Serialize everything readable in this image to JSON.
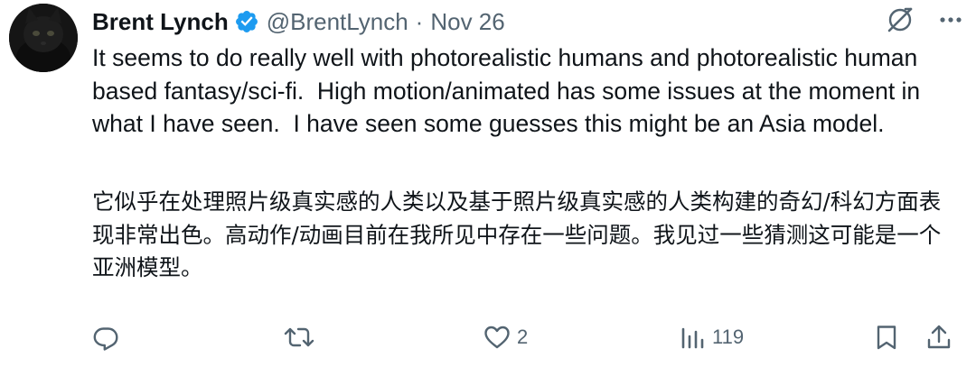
{
  "user": {
    "display_name": "Brent Lynch",
    "handle": "@BrentLynch",
    "separator": "·",
    "date": "Nov 26",
    "verified": true
  },
  "tweet": {
    "text_en": "It seems to do really well with photorealistic humans and photorealistic human based fantasy/sci-fi.  High motion/animated has some issues at the moment in what I have seen.  I have seen some guesses this might be an Asia model.",
    "text_zh": "它似乎在处理照片级真实感的人类以及基于照片级真实感的人类构建的奇幻/科幻方面表现非常出色。高动作/动画目前在我所见中存在一些问题。我见过一些猜测这可能是一个亚洲模型。"
  },
  "actions": {
    "reply_count": "",
    "retweet_count": "",
    "like_count": "2",
    "views_count": "119"
  },
  "icons": {
    "verified": "verified-badge-icon",
    "grok": "grok-icon",
    "more": "more-icon",
    "reply": "reply-icon",
    "retweet": "retweet-icon",
    "like": "heart-icon",
    "views": "views-icon",
    "bookmark": "bookmark-icon",
    "share": "share-icon"
  },
  "colors": {
    "text": "#0f1419",
    "secondary": "#536471",
    "verified": "#1d9bf0",
    "background": "#ffffff"
  }
}
